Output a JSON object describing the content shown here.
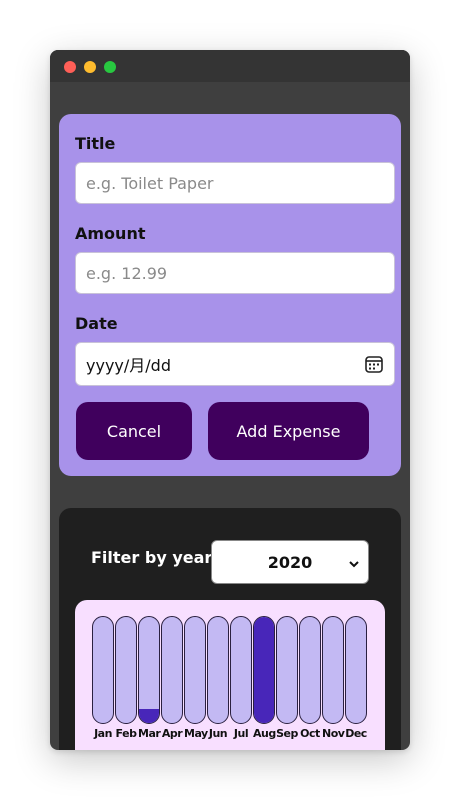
{
  "form": {
    "title_label": "Title",
    "title_placeholder": "e.g. Toilet Paper",
    "amount_label": "Amount",
    "amount_placeholder": "e.g. 12.99",
    "date_label": "Date",
    "date_value": "yyyy/月/dd",
    "cancel_label": "Cancel",
    "add_label": "Add Expense"
  },
  "filter": {
    "label": "Filter by year",
    "selected_year": "2020"
  },
  "chart_data": {
    "type": "bar",
    "categories": [
      "Jan",
      "Feb",
      "Mar",
      "Apr",
      "May",
      "Jun",
      "Jul",
      "Aug",
      "Sep",
      "Oct",
      "Nov",
      "Dec"
    ],
    "values": [
      0,
      0,
      0.13,
      0,
      0,
      0,
      0,
      1.0,
      0,
      0,
      0,
      0
    ],
    "ylim": [
      0,
      1
    ]
  },
  "colors": {
    "form_bg": "#a892ea",
    "button_bg": "#40005d",
    "chart_bg": "#f8dfff",
    "bar_empty": "#c3b9f3",
    "bar_fill": "#4826b9",
    "card_dark": "#1f1f1f"
  }
}
